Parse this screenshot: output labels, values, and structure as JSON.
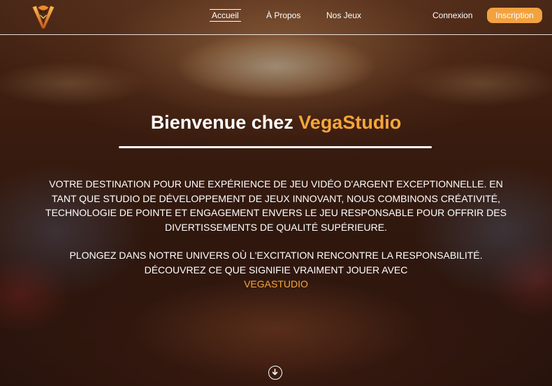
{
  "nav": {
    "items": [
      {
        "label": "Accueil",
        "active": true
      },
      {
        "label": "À Propos",
        "active": false
      },
      {
        "label": "Nos Jeux",
        "active": false
      }
    ],
    "login_label": "Connexion",
    "signup_label": "Inscription"
  },
  "hero": {
    "title_prefix": "Bienvenue chez",
    "title_brand": "VegaStudio",
    "paragraph1": "Votre destination pour une expérience de jeu vidéo d'argent exceptionnelle. En tant que studio de développement de jeux innovant, nous combinons créativité, technologie de pointe et engagement envers le jeu responsable pour offrir des divertissements de qualité supérieure.",
    "paragraph2": "Plongez dans notre univers où l'excitation rencontre la responsabilité. Découvrez ce que signifie vraiment jouer avec",
    "paragraph2_brand": "VegaStudio"
  },
  "colors": {
    "accent": "#f5a63c",
    "signup_button": "#f2a23f",
    "text": "#ffffff"
  },
  "icons": {
    "logo": "vegastudio-v-logo",
    "scroll": "arrow-down-circle-icon"
  }
}
